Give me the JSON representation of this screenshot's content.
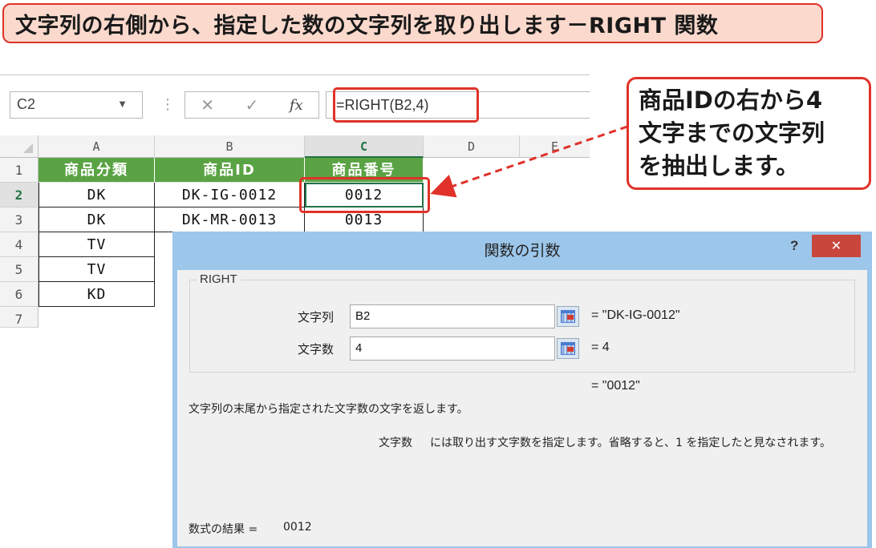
{
  "banner": {
    "title": "文字列の右側から、指定した数の文字列を取り出します－RIGHT 関数"
  },
  "formula_bar": {
    "name_box": "C2",
    "name_box_caret": "▼",
    "dots": "⋮",
    "cancel": "✕",
    "enter": "✓",
    "fx": "fx",
    "formula": "=RIGHT(B2,4)"
  },
  "sheet": {
    "columns": [
      "A",
      "B",
      "C",
      "D",
      "E"
    ],
    "rows": [
      "1",
      "2",
      "3",
      "4",
      "5",
      "6",
      "7"
    ],
    "header_row": [
      "商品分類",
      "商品ID",
      "商品番号"
    ],
    "data": [
      [
        "DK",
        "DK-IG-0012",
        "0012"
      ],
      [
        "DK",
        "DK-MR-0013",
        "0013"
      ],
      [
        "TV",
        "",
        ""
      ],
      [
        "TV",
        "",
        ""
      ],
      [
        "KD",
        "",
        ""
      ]
    ]
  },
  "callout": {
    "lines": [
      "商品IDの右から4",
      "文字までの文字列",
      "を抽出します。"
    ]
  },
  "dialog": {
    "title": "関数の引数",
    "help": "?",
    "close": "✕",
    "function_name": "RIGHT",
    "args": [
      {
        "label": "文字列",
        "value": "B2",
        "result": "= \"DK-IG-0012\""
      },
      {
        "label": "文字数",
        "value": "4",
        "result": "= 4"
      }
    ],
    "total_result": "= \"0012\"",
    "description": "文字列の末尾から指定された文字数の文字を返します。",
    "arg_help_name": "文字数",
    "arg_help": "には取り出す文字数を指定します。省略すると、1 を指定したと見なされます。",
    "formula_result_label": "数式の結果 =",
    "formula_result_value": "0012"
  },
  "colors": {
    "accent_red": "#e0322a",
    "header_green": "#5aa344",
    "dialog_blue": "#9cc6ea",
    "banner_fill": "#fbd9cc"
  }
}
